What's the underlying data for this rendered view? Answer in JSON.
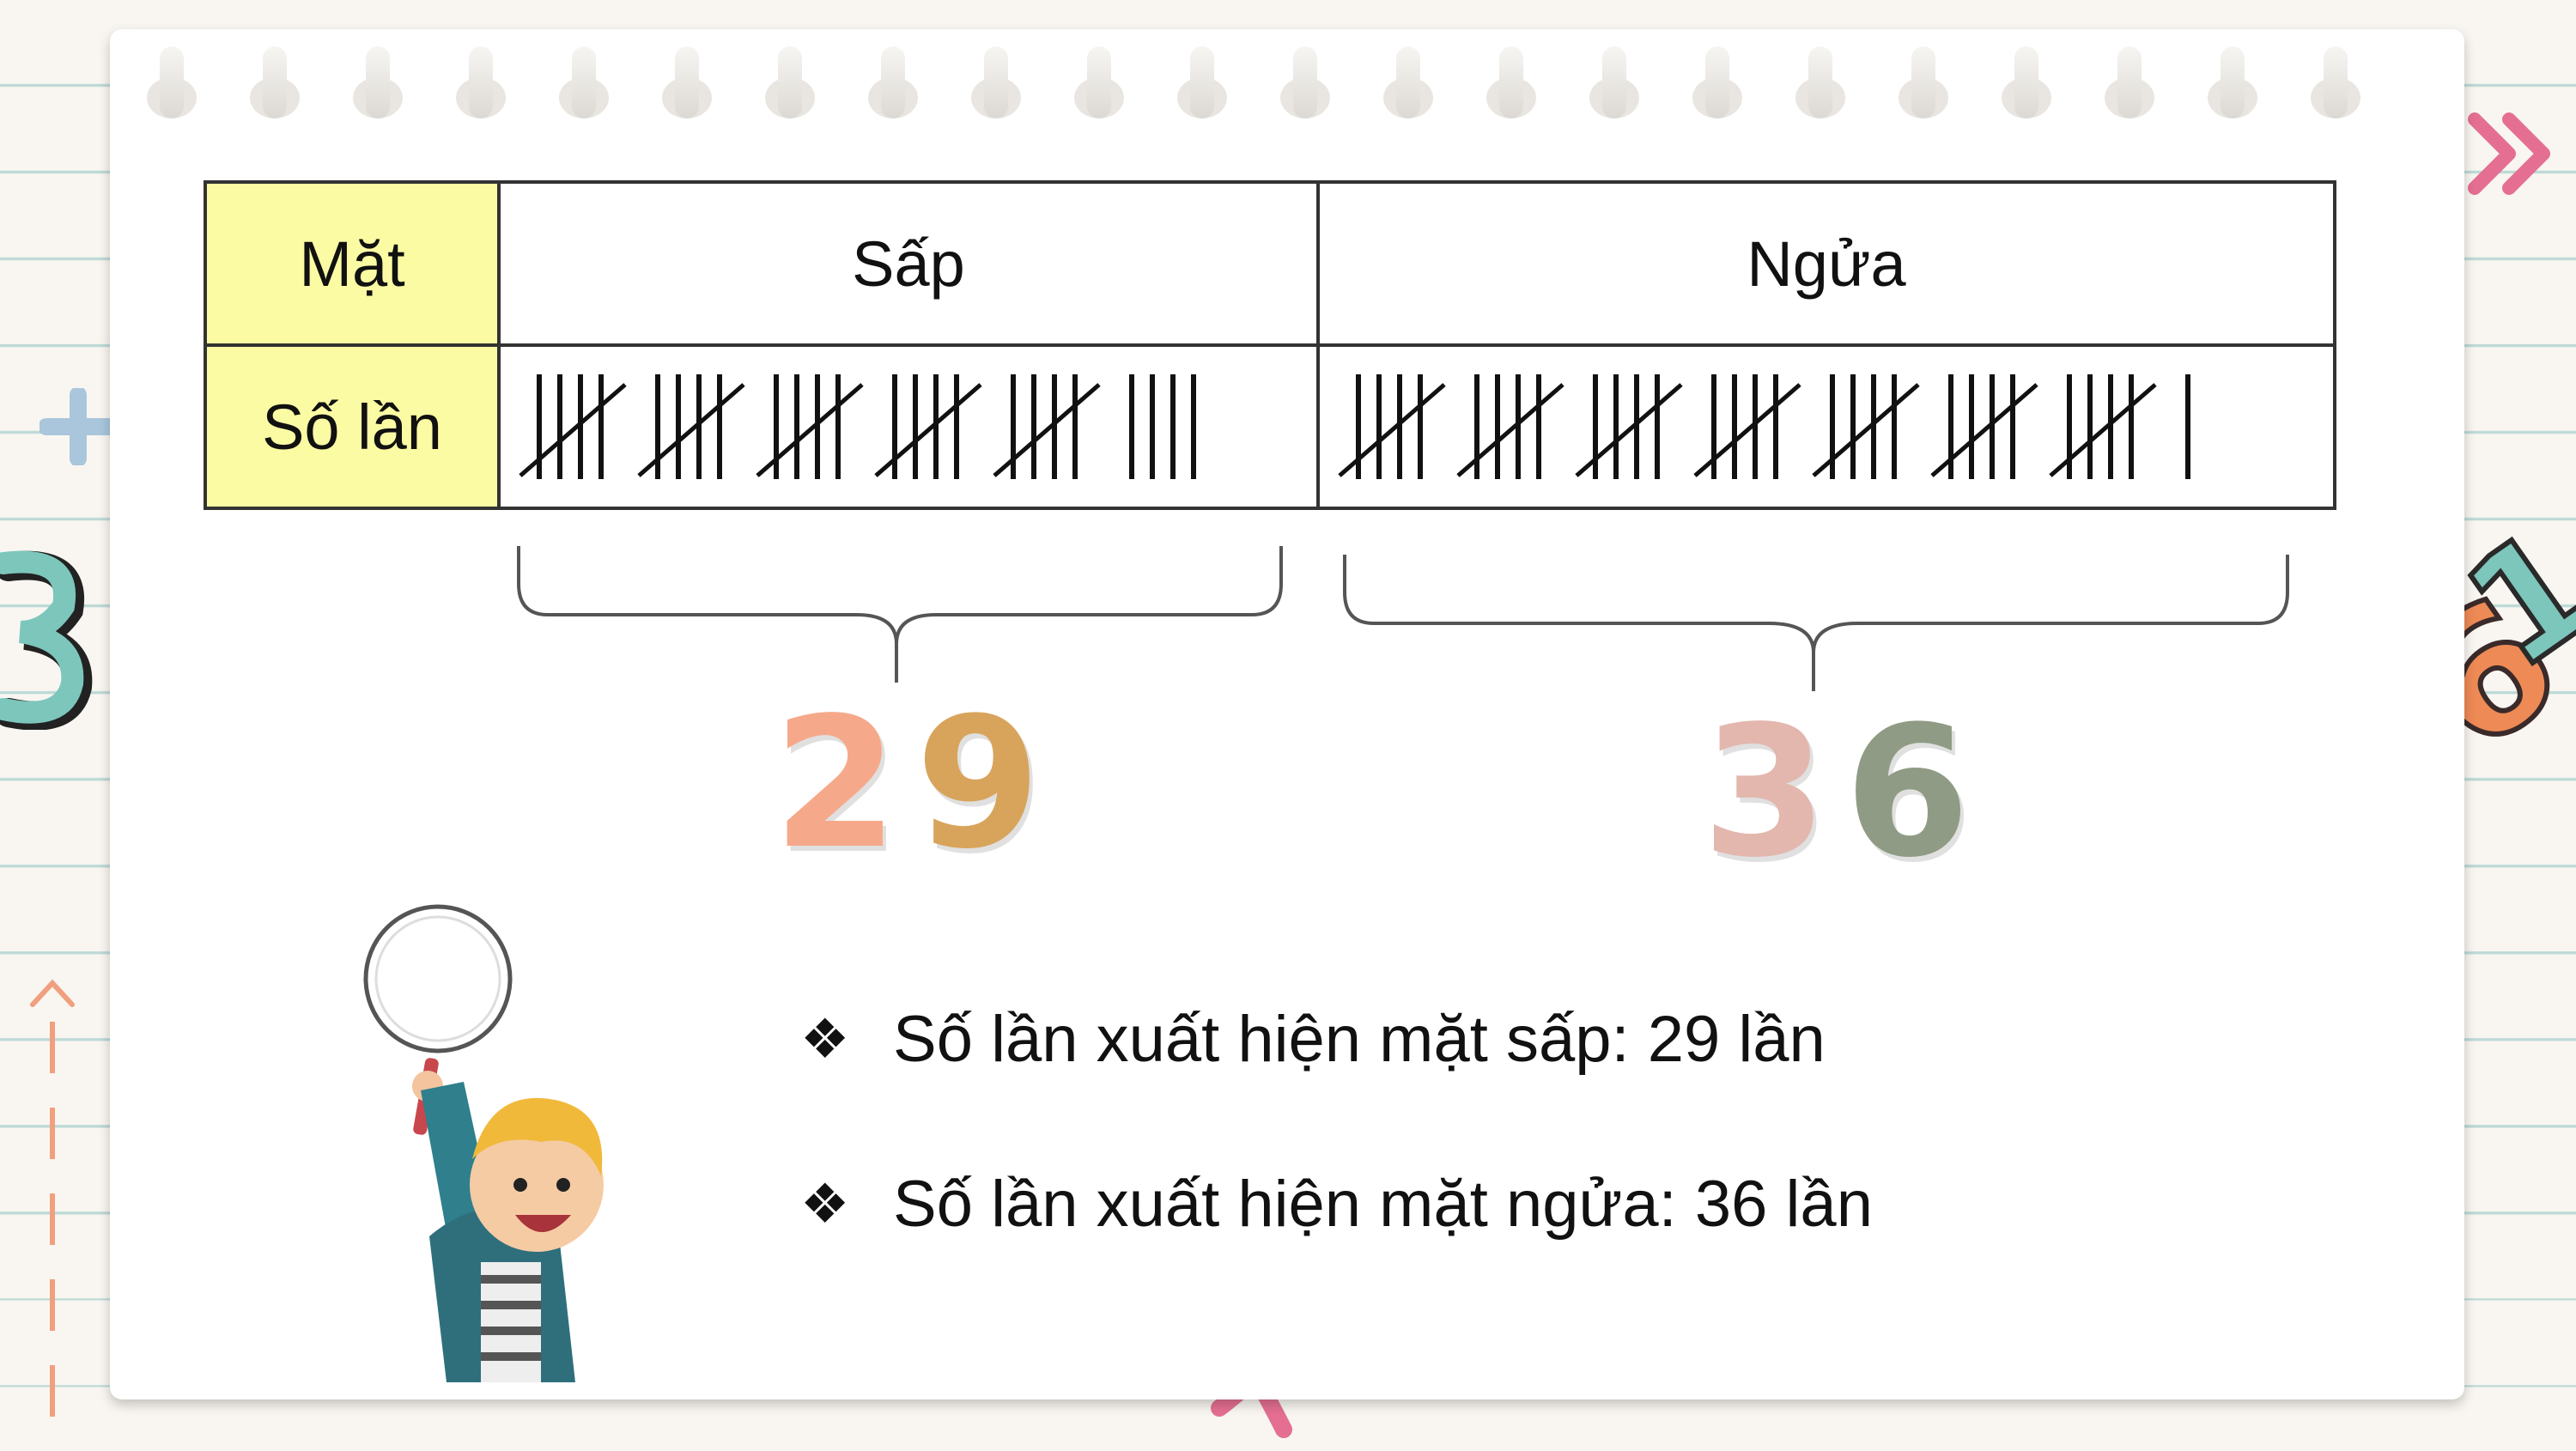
{
  "table": {
    "row1": {
      "header": "Mặt",
      "col1": "Sấp",
      "col2": "Ngửa"
    },
    "row2": {
      "header": "Số lần"
    },
    "tally_counts": {
      "sap": 29,
      "ngua": 36
    }
  },
  "totals": {
    "sap": [
      "2",
      "9"
    ],
    "ngua": [
      "3",
      "6"
    ]
  },
  "bullets": [
    {
      "icon": "❖",
      "text": "Số lần xuất hiện mặt sấp: 29 lần"
    },
    {
      "icon": "❖",
      "text": "Số lần xuất hiện mặt ngửa: 36 lần"
    }
  ],
  "colors": {
    "header_fill": "#fbfba4",
    "digit_2": "#f6a98a",
    "digit_9": "#d8a45c",
    "digit_3": "#e3b7ae",
    "digit_6": "#8f9b84",
    "paper_lines": "#bcd9d6"
  },
  "decorations": [
    "plus-icon",
    "three-doodle",
    "arrow-up-icon",
    "double-chevron-icon",
    "number-doodle",
    "x-mark-icon",
    "boy-with-magnifier"
  ]
}
